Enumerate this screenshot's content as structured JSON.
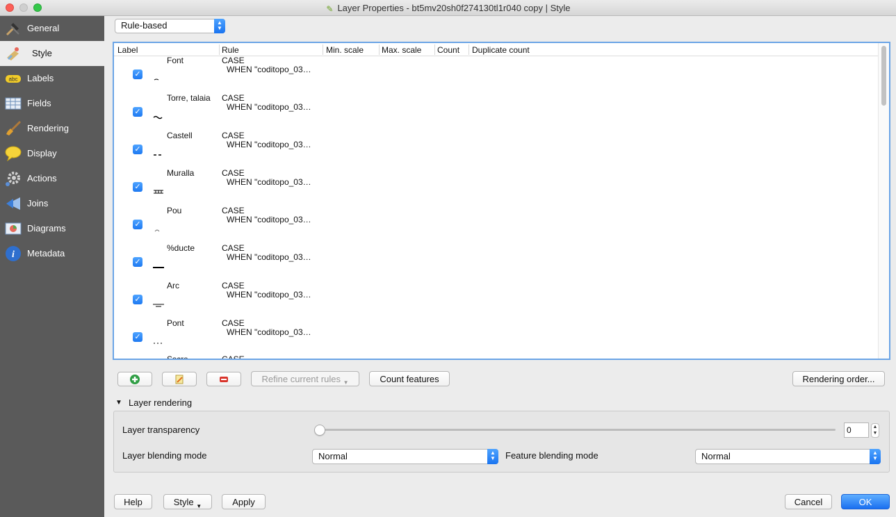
{
  "window": {
    "title": "Layer Properties - bt5mv20sh0f274130tl1r040 copy | Style"
  },
  "sidebar": {
    "items": [
      {
        "label": "General",
        "icon": "hammer-icon"
      },
      {
        "label": "Style",
        "icon": "paint-icon"
      },
      {
        "label": "Labels",
        "icon": "abc-label-icon"
      },
      {
        "label": "Fields",
        "icon": "table-icon"
      },
      {
        "label": "Rendering",
        "icon": "brush-icon"
      },
      {
        "label": "Display",
        "icon": "speech-bubble-icon"
      },
      {
        "label": "Actions",
        "icon": "gear-icon"
      },
      {
        "label": "Joins",
        "icon": "join-icon"
      },
      {
        "label": "Diagrams",
        "icon": "diagram-icon"
      },
      {
        "label": "Metadata",
        "icon": "info-icon"
      }
    ]
  },
  "renderer": {
    "selected": "Rule-based"
  },
  "rules_table": {
    "columns": [
      "Label",
      "Rule",
      "Min. scale",
      "Max. scale",
      "Count",
      "Duplicate count"
    ],
    "rows": [
      {
        "label": "Font",
        "rule_line1": "CASE",
        "rule_line2": "WHEN \"coditopo_03…",
        "checked": true
      },
      {
        "label": "Torre, talaia",
        "rule_line1": "CASE",
        "rule_line2": "WHEN \"coditopo_03…",
        "checked": true
      },
      {
        "label": "Castell",
        "rule_line1": "CASE",
        "rule_line2": "WHEN \"coditopo_03…",
        "checked": true
      },
      {
        "label": "Muralla",
        "rule_line1": "CASE",
        "rule_line2": "WHEN \"coditopo_03…",
        "checked": true
      },
      {
        "label": "Pou",
        "rule_line1": "CASE",
        "rule_line2": "WHEN \"coditopo_03…",
        "checked": true
      },
      {
        "label": "%ducte",
        "rule_line1": "CASE",
        "rule_line2": "WHEN \"coditopo_03…",
        "checked": true
      },
      {
        "label": "Arc",
        "rule_line1": "CASE",
        "rule_line2": "WHEN \"coditopo_03…",
        "checked": true
      },
      {
        "label": "Pont",
        "rule_line1": "CASE",
        "rule_line2": "WHEN \"coditopo_03…",
        "checked": true
      },
      {
        "label": "Sscre",
        "rule_line1": "CASE",
        "rule_line2": "",
        "checked": true
      }
    ]
  },
  "toolbar": {
    "refine_label": "Refine current rules",
    "count_label": "Count features",
    "rendering_order_label": "Rendering order..."
  },
  "layer_rendering": {
    "title": "Layer rendering",
    "transparency_label": "Layer transparency",
    "transparency_value": "0",
    "blending_label": "Layer blending mode",
    "blending_value": "Normal",
    "feature_blending_label": "Feature blending mode",
    "feature_blending_value": "Normal"
  },
  "footer": {
    "help": "Help",
    "style": "Style",
    "apply": "Apply",
    "cancel": "Cancel",
    "ok": "OK"
  },
  "colors": {
    "accent": "#1e79f2",
    "sidebar": "#5a5a5a",
    "selection_border": "#6aa4e6"
  }
}
